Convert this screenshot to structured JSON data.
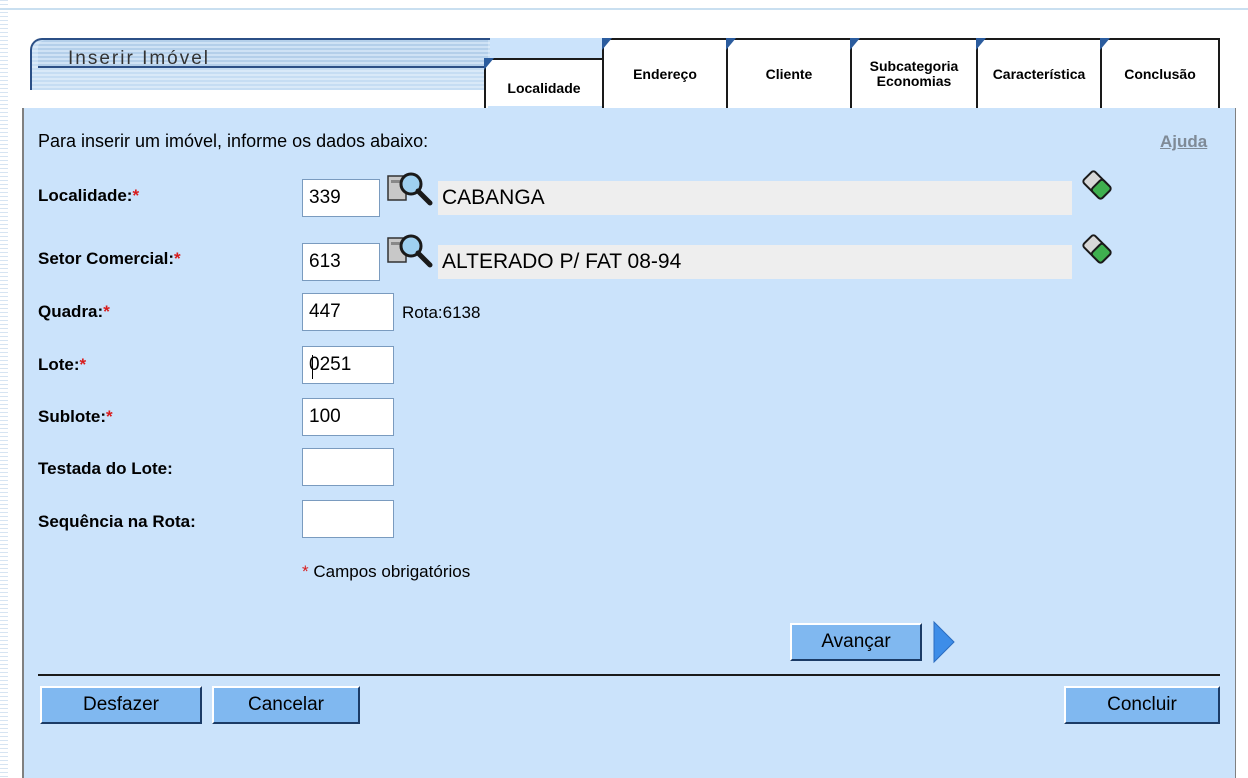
{
  "header": {
    "title": "Inserir Imóvel"
  },
  "tabs": [
    {
      "label": "Localidade"
    },
    {
      "label": "Endereço"
    },
    {
      "label": "Cliente"
    },
    {
      "label_line1": "Subcategoria",
      "label_line2": "Economias"
    },
    {
      "label": "Característica"
    },
    {
      "label": "Conclusão"
    }
  ],
  "form": {
    "instructions": "Para inserir um imóvel, informe os dados abaixo:",
    "help_link": "Ajuda",
    "required_mark": "*",
    "localidade": {
      "label": "Localidade:",
      "code": "339",
      "name": "CABANGA"
    },
    "setor_comercial": {
      "label": "Setor Comercial:",
      "code": "613",
      "name": "ALTERADO P/ FAT 08-94"
    },
    "quadra": {
      "label": "Quadra:",
      "value": "447",
      "rota": "Rota:6138"
    },
    "lote": {
      "label": "Lote:",
      "value": "0251"
    },
    "sublote": {
      "label": "Sublote:",
      "value": "100"
    },
    "testada": {
      "label": "Testada do Lote:",
      "value": ""
    },
    "sequencia": {
      "label": "Sequência na Rota:",
      "value": ""
    },
    "required_note": "Campos obrigatórios"
  },
  "buttons": {
    "avancar": "Avançar",
    "desfazer": "Desfazer",
    "cancelar": "Cancelar",
    "concluir": "Concluir"
  },
  "colors": {
    "panel_bg": "#cbe3fb",
    "button_bg": "#80b8f0",
    "required": "#d81b1b",
    "tab_accent": "#2b5c9e"
  }
}
